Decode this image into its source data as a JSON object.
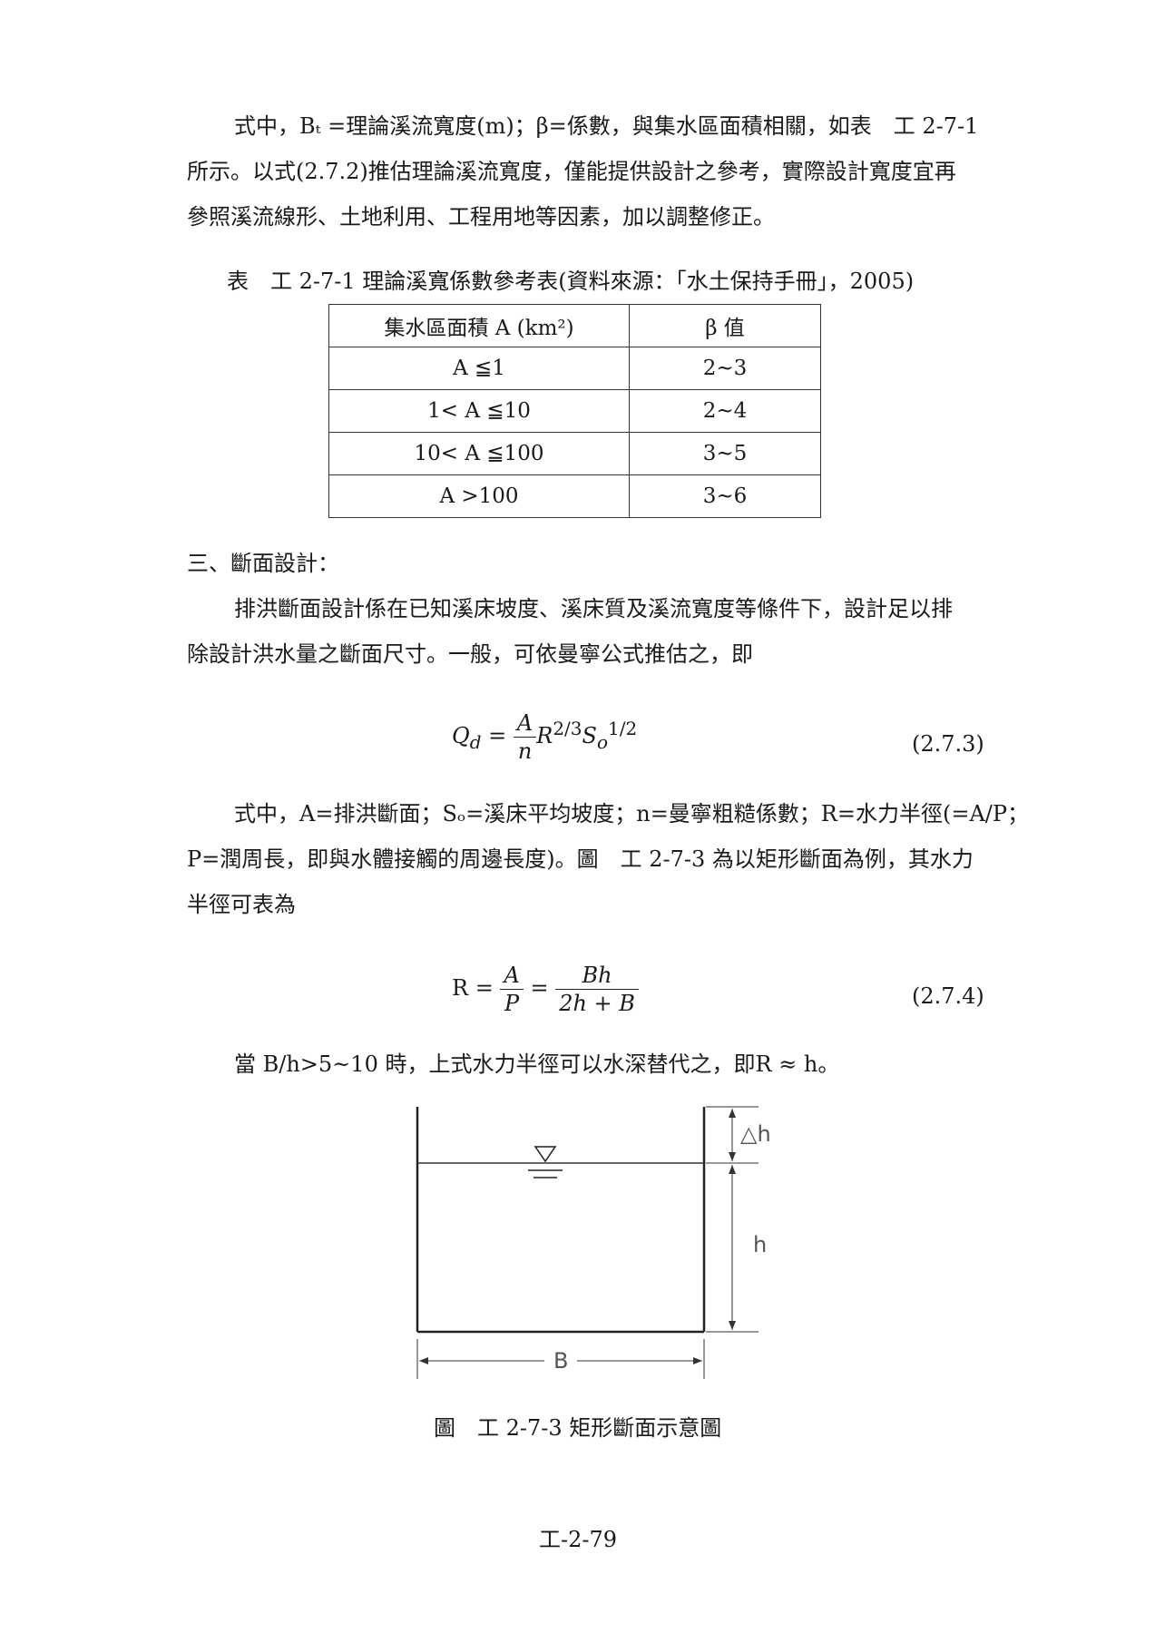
{
  "paragraph1": {
    "line1": "式中，Bₜ =理論溪流寬度(m)；β=係數，與集水區面積相關，如表　工 2-7-1",
    "line2": "所示。以式(2.7.2)推估理論溪流寬度，僅能提供設計之參考，實際設計寬度宜再",
    "line3": "參照溪流線形、土地利用、工程用地等因素，加以調整修正。"
  },
  "table": {
    "caption": "表　工 2-7-1 理論溪寬係數參考表(資料來源：「水土保持手冊」，2005)",
    "header": [
      "集水區面積 A (km²)",
      "β 值"
    ],
    "rows": [
      [
        "A ≦1",
        "2~3"
      ],
      [
        "1< A ≦10",
        "2~4"
      ],
      [
        "10< A ≦100",
        "3~5"
      ],
      [
        "A >100",
        "3~6"
      ]
    ]
  },
  "section3": {
    "heading": "三、斷面設計：",
    "line1": "排洪斷面設計係在已知溪床坡度、溪床質及溪流寬度等條件下，設計足以排",
    "line2": "除設計洪水量之斷面尺寸。一般，可依曼寧公式推估之，即"
  },
  "equation1": {
    "lhs": "Q",
    "lhs_sub": "d",
    "eq": "=",
    "num": "A",
    "den": "n",
    "r": "R",
    "r_sup": "2/3",
    "s": "S",
    "s_sub": "o",
    "s_sup": "1/2",
    "number": "(2.7.3)"
  },
  "paragraph2": {
    "line1": "式中，A=排洪斷面；Sₒ=溪床平均坡度；n=曼寧粗糙係數；R=水力半徑(=A/P；",
    "line2": "P=潤周長，即與水體接觸的周邊長度)。圖　工 2-7-3 為以矩形斷面為例，其水力",
    "line3": "半徑可表為"
  },
  "equation2": {
    "lhs": "R =",
    "num1": "A",
    "den1": "P",
    "eq": "=",
    "num2": "Bh",
    "den2": "2h + B",
    "number": "(2.7.4)"
  },
  "paragraph3": {
    "line1": "當 B/h>5~10 時，上式水力半徑可以水深替代之，即R ≈ h。"
  },
  "figure": {
    "label_delta_h": "△h",
    "label_h": "h",
    "label_B": "B",
    "caption": "圖　工 2-7-3 矩形斷面示意圖"
  },
  "page_number": "工-2-79"
}
